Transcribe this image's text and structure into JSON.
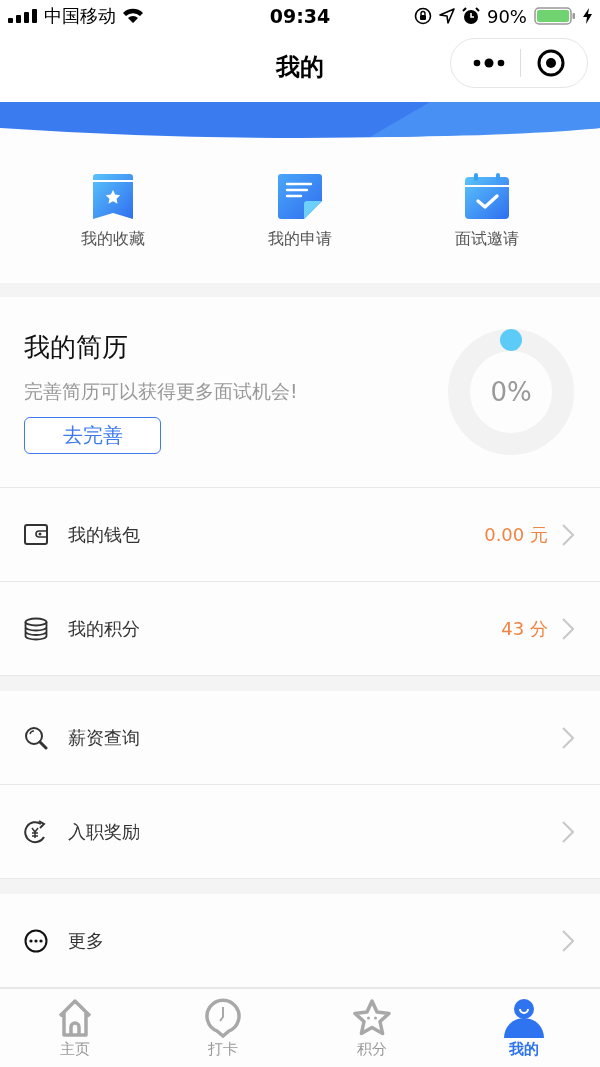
{
  "status_bar": {
    "carrier": "中国移动",
    "time": "09:34",
    "battery": "90%"
  },
  "nav": {
    "title": "我的"
  },
  "shortcuts": [
    {
      "label": "我的收藏"
    },
    {
      "label": "我的申请"
    },
    {
      "label": "面试邀请"
    }
  ],
  "resume": {
    "title": "我的简历",
    "hint": "完善简历可以获得更多面试机会!",
    "button": "去完善",
    "level": 0,
    "percent": "0%"
  },
  "menu_groups": [
    [
      {
        "label": "我的钱包",
        "value": "0.00 元"
      },
      {
        "label": "我的积分",
        "value": "43 分"
      }
    ],
    [
      {
        "label": "薪资查询"
      },
      {
        "label": "入职奖励"
      }
    ],
    [
      {
        "label": "更多"
      }
    ]
  ],
  "tabs": [
    {
      "label": "主页",
      "selected": false
    },
    {
      "label": "打卡",
      "selected": false
    },
    {
      "label": "积分",
      "selected": false
    },
    {
      "label": "我的",
      "selected": true
    }
  ]
}
